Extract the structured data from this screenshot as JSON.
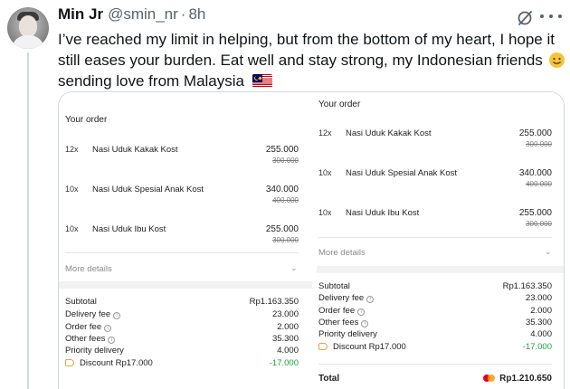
{
  "tweet": {
    "display_name": "Min Jr",
    "handle": "@smin_nr",
    "separator": "·",
    "time": "8h",
    "text_main": "I’ve reached my limit in helping, but from the bottom of my heart, I hope it still eases your burden. Eat well and stay strong, my Indonesian friends",
    "text_tail": "sending love from Malaysia",
    "emoji_1": "smiling-face-with-tear",
    "emoji_2": "flag-malaysia"
  },
  "order_left": {
    "title": "Your order",
    "items": [
      {
        "qty": "12x",
        "name": "Nasi Uduk Kakak Kost",
        "price": "255.000",
        "old_price": "300.000"
      },
      {
        "qty": "10x",
        "name": "Nasi Uduk Spesial Anak Kost",
        "price": "340.000",
        "old_price": "400.000"
      },
      {
        "qty": "10x",
        "name": "Nasi Uduk Ibu Kost",
        "price": "255.000",
        "old_price": "300.000"
      }
    ],
    "more_details": "More details",
    "subtotal_label": "Subtotal",
    "subtotal_value": "Rp1.163.350",
    "delivery_label": "Delivery fee",
    "delivery_value": "23.000",
    "order_fee_label": "Order fee",
    "order_fee_value": "2.000",
    "other_fees_label": "Other fees",
    "other_fees_value": "35.300",
    "priority_label": "Priority delivery",
    "priority_value": "4.000",
    "discount_label": "Discount Rp17.000",
    "discount_value": "-17.000"
  },
  "order_right": {
    "title": "Your order",
    "items": [
      {
        "qty": "12x",
        "name": "Nasi Uduk Kakak Kost",
        "price": "255.000",
        "old_price": "300.000"
      },
      {
        "qty": "10x",
        "name": "Nasi Uduk Spesial Anak Kost",
        "price": "340.000",
        "old_price": "400.000"
      },
      {
        "qty": "10x",
        "name": "Nasi Uduk Ibu Kost",
        "price": "255.000",
        "old_price": "300.000"
      }
    ],
    "more_details": "More details",
    "subtotal_label": "Subtotal",
    "subtotal_value": "Rp1.163.350",
    "delivery_label": "Delivery fee",
    "delivery_value": "23.000",
    "order_fee_label": "Order fee",
    "order_fee_value": "2.000",
    "other_fees_label": "Other fees",
    "other_fees_value": "35.300",
    "priority_label": "Priority delivery",
    "priority_value": "4.000",
    "discount_label": "Discount Rp17.000",
    "discount_value": "-17.000",
    "total_label": "Total",
    "total_value": "Rp1.210.650",
    "payment_icon": "mastercard-icon"
  },
  "colors": {
    "text": "#0f1419",
    "secondary": "#536471",
    "discount_green": "#1e9e3f",
    "divider": "#cfd9de"
  }
}
